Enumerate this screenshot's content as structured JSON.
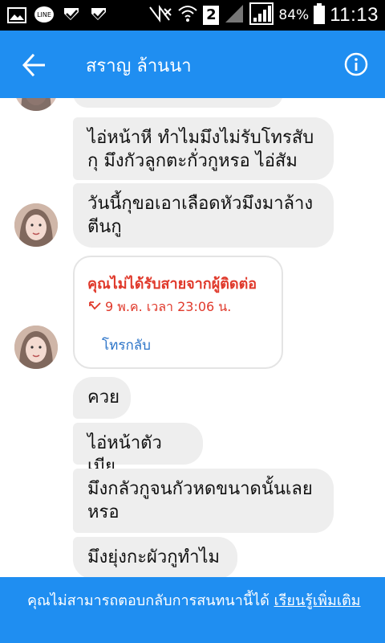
{
  "statusbar": {
    "battery": "84%",
    "time": "11:13",
    "icons_left": [
      "image-icon",
      "line-app-icon",
      "checkmark-notify-icon",
      "checkmark-notify-icon"
    ],
    "icons_right": [
      "no-sim-icon",
      "wifi-icon",
      "sim2-badge",
      "signal-icon",
      "signal-bars-icon",
      "battery-icon"
    ],
    "sim_badge": "2"
  },
  "header": {
    "title": "สราญ ล้านนา",
    "background": "#1f8ef1"
  },
  "messages": [
    {
      "text": "ไอ่หน้าหี ทำไมมึงไม่รับโทรสับกุ มึงกัวลูกตะกั่วกูหรอ ไอ่สัม"
    },
    {
      "text": "วันนี้กุขอเอาเลือดหัวมึงมาล้างตีนกู"
    },
    {
      "text": "ควย"
    },
    {
      "text": "ไอ่หน้าตัวเมีย"
    },
    {
      "text": "มึงกลัวกูจนกัวหดขนาดนั้นเลยหรอ"
    },
    {
      "text": "มึงยุ่งกะผัวกูทำไม"
    }
  ],
  "missed_call": {
    "title": "คุณไม่ได้รับสายจากผู้ติดต่อ",
    "time": "9 พ.ค. เวลา 23:06 น.",
    "action": "โทรกลับ",
    "accent": "#e0392b",
    "link_color": "#2a73c8"
  },
  "footer": {
    "text": "คุณไม่สามารถตอบกลับการสนทนานี้ได้ ",
    "link": "เรียนรู้เพิ่มเติม"
  }
}
